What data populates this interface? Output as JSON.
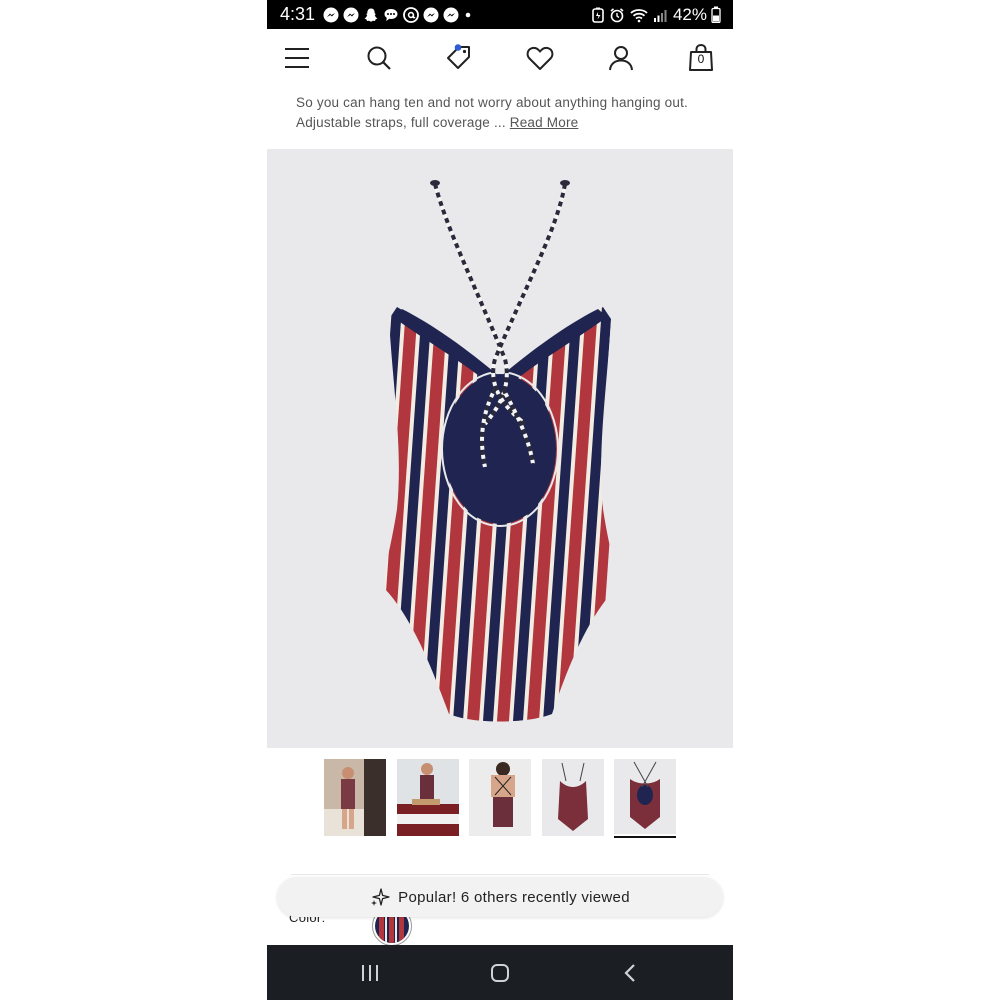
{
  "status_bar": {
    "time": "4:31",
    "battery": "42%",
    "notification_icons": [
      "messenger-icon",
      "messenger-icon",
      "snapchat-icon",
      "chat-bubble-icon",
      "threads-icon",
      "messenger-icon",
      "messenger-icon",
      "dot-icon"
    ],
    "status_icons": [
      "battery-saver-icon",
      "alarm-icon",
      "wifi-icon",
      "signal-icon",
      "battery-icon"
    ]
  },
  "header": {
    "cart_count": "0",
    "icons": [
      "menu-icon",
      "search-icon",
      "deals-tag-icon",
      "heart-icon",
      "account-icon",
      "shopping-bag-icon"
    ]
  },
  "product": {
    "description_line1": "So you can hang ten and not worry about anything hanging out.",
    "description_line2": "Adjustable straps, full coverage ...",
    "read_more": "Read More",
    "thumbnail_count": 5,
    "selected_thumbnail": 5,
    "color_label": "Color:"
  },
  "banner": {
    "text": "Popular! 6 others recently viewed"
  },
  "colors": {
    "navy": "#1f2550",
    "red": "#b2363e",
    "cream": "#f3ece2",
    "image_bg": "#e9e9eb"
  }
}
